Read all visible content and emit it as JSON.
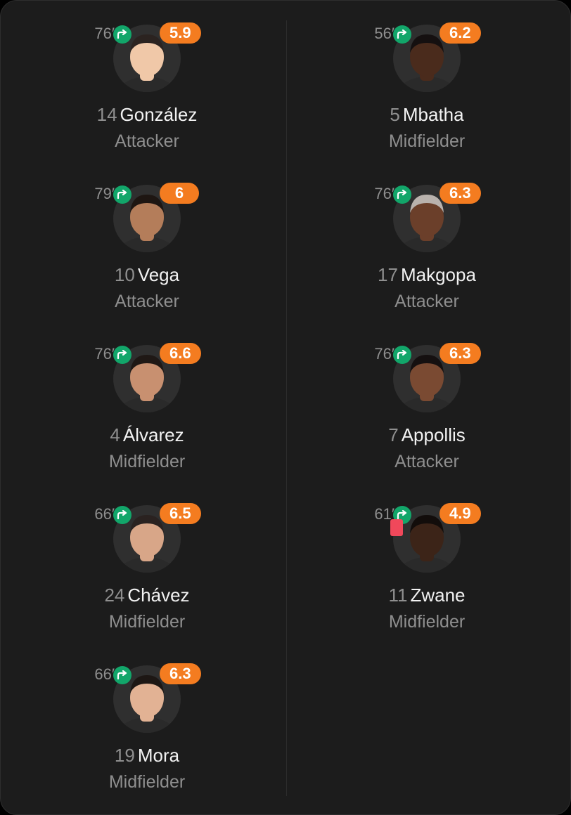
{
  "left": [
    {
      "minute": "76′",
      "rating": "5.9",
      "number": "14",
      "name": "González",
      "position": "Attacker",
      "skin": "#f0c8a8",
      "hair": "#2b2320"
    },
    {
      "minute": "79′",
      "rating": "6",
      "number": "10",
      "name": "Vega",
      "position": "Attacker",
      "skin": "#b47d5a",
      "hair": "#1e1612"
    },
    {
      "minute": "76′",
      "rating": "6.6",
      "number": "4",
      "name": "Álvarez",
      "position": "Midfielder",
      "skin": "#c89070",
      "hair": "#1f1815"
    },
    {
      "minute": "66′",
      "rating": "6.5",
      "number": "24",
      "name": "Chávez",
      "position": "Midfielder",
      "skin": "#d8a688",
      "hair": "#2a2220"
    },
    {
      "minute": "66′",
      "rating": "6.3",
      "number": "19",
      "name": "Mora",
      "position": "Midfielder",
      "skin": "#e2b294",
      "hair": "#1d1714"
    }
  ],
  "right": [
    {
      "minute": "56′",
      "rating": "6.2",
      "number": "5",
      "name": "Mbatha",
      "position": "Midfielder",
      "skin": "#4a2b1c",
      "hair": "#151010"
    },
    {
      "minute": "76′",
      "rating": "6.3",
      "number": "17",
      "name": "Makgopa",
      "position": "Attacker",
      "skin": "#6b3f2a",
      "hair": "#b9b2ad"
    },
    {
      "minute": "76′",
      "rating": "6.3",
      "number": "7",
      "name": "Appollis",
      "position": "Attacker",
      "skin": "#7a4a32",
      "hair": "#151010"
    },
    {
      "minute": "61′",
      "rating": "4.9",
      "number": "11",
      "name": "Zwane",
      "position": "Midfielder",
      "skin": "#3c2418",
      "hair": "#120d0b"
    }
  ],
  "icons": {
    "sub": "substitution-arrow-icon",
    "card": "red-card-icon"
  },
  "colors": {
    "rating_bg": "#f47c20",
    "sub_bg": "#12a66a",
    "red_card": "#f0485b",
    "card_bg": "#1c1c1c"
  }
}
